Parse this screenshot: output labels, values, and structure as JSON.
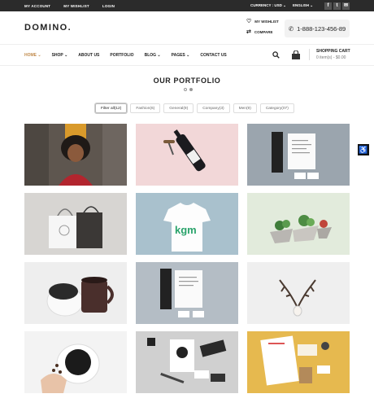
{
  "topbar": {
    "links": [
      "MY ACCOUNT",
      "MY WISHLIST",
      "LOGIN"
    ],
    "currency": "CURRENCY : USD",
    "language": "ENGLISH",
    "social": [
      "f",
      "t",
      "✉"
    ]
  },
  "header": {
    "logo": "DOMINO.",
    "wishlist": "MY WISHLIST",
    "compare": "COMPARE",
    "phone": "1-888-123-456-89"
  },
  "nav": {
    "items": [
      "HOME",
      "SHOP",
      "ABOUT US",
      "PORTFOLIO",
      "BLOG",
      "PAGES",
      "CONTACT US"
    ],
    "cart_title": "SHOPPING CART",
    "cart_summary": "0 item(s) - $0.00"
  },
  "portfolio": {
    "title": "OUR PORTFOLIO",
    "filters": [
      "Filter all(12)",
      "Fashion(6)",
      "General(9)",
      "Company(3)",
      "Men(9)",
      "Category(07)"
    ]
  },
  "colors": {
    "accent": "#c08a4b",
    "topbar": "#2b2b2b"
  }
}
